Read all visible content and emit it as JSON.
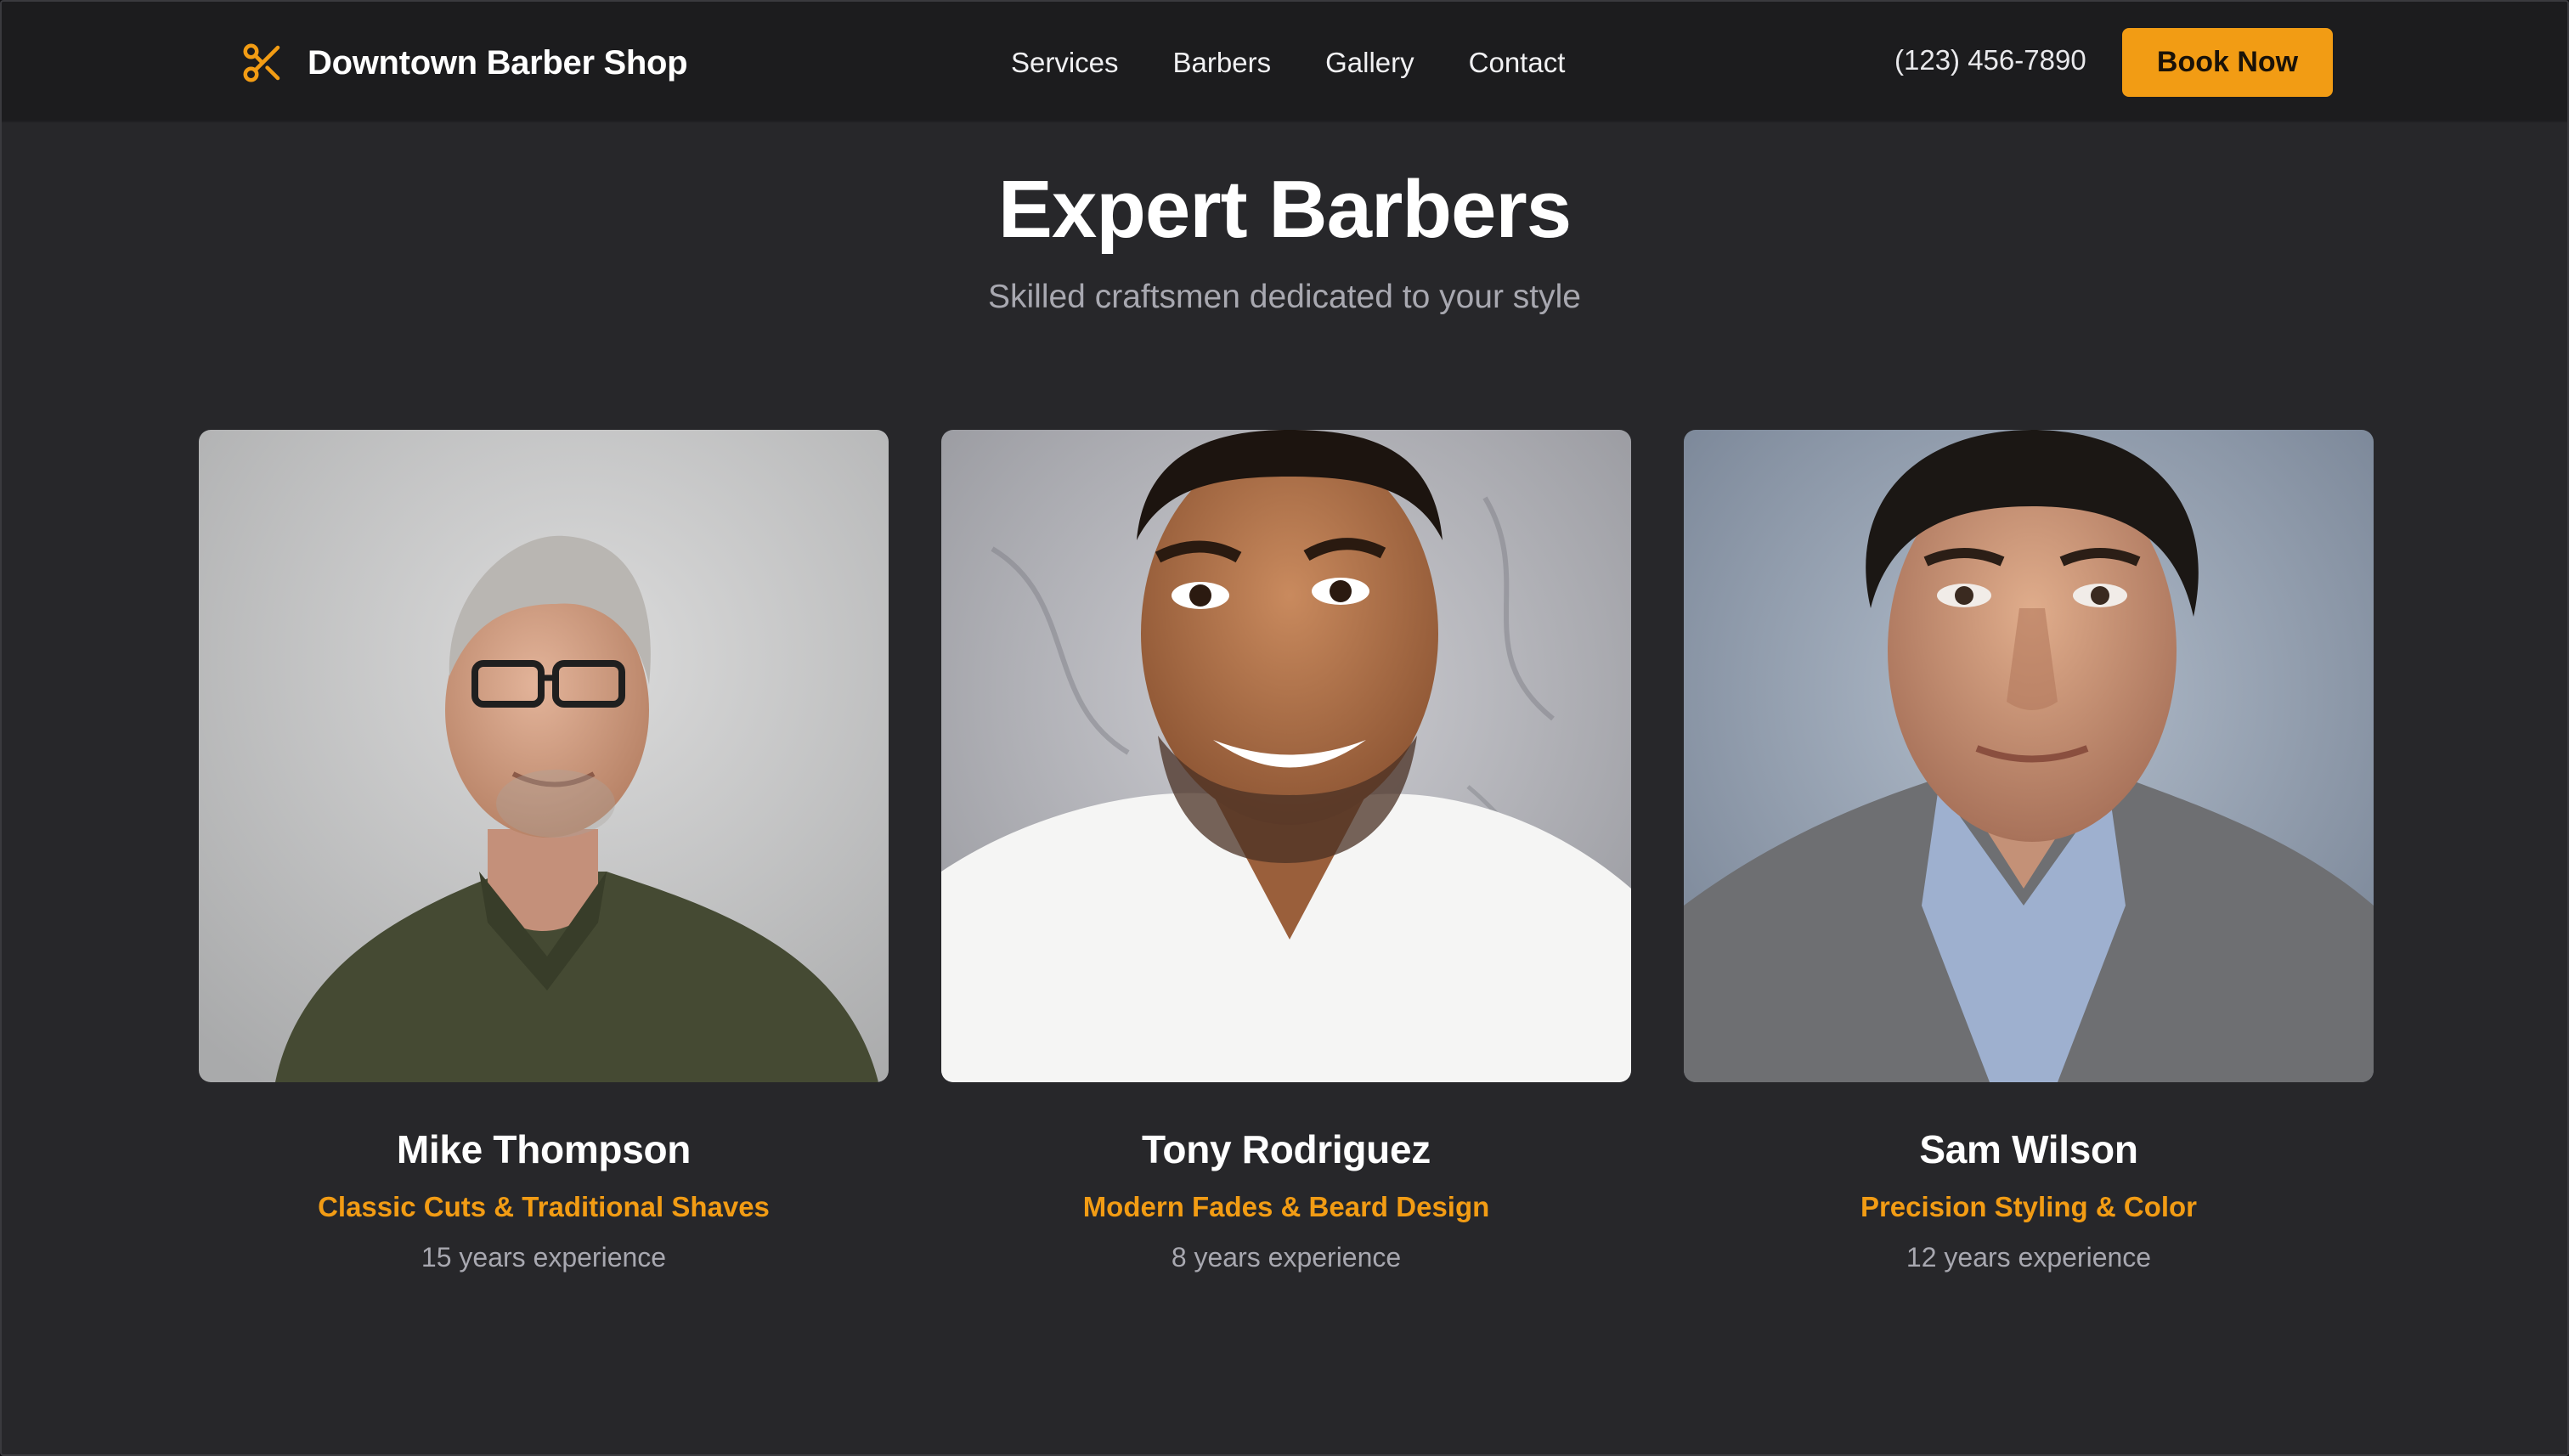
{
  "navbar": {
    "brand_name": "Downtown Barber Shop",
    "brand_icon": "scissors-icon",
    "links": [
      "Services",
      "Barbers",
      "Gallery",
      "Contact"
    ],
    "phone": "(123) 456-7890",
    "cta_label": "Book Now"
  },
  "section": {
    "title": "Expert Barbers",
    "subtitle": "Skilled craftsmen dedicated to your style"
  },
  "barbers": [
    {
      "name": "Mike Thompson",
      "specialty": "Classic Cuts & Traditional Shaves",
      "experience": "15 years experience"
    },
    {
      "name": "Tony Rodriguez",
      "specialty": "Modern Fades & Beard Design",
      "experience": "8 years experience"
    },
    {
      "name": "Sam Wilson",
      "specialty": "Precision Styling & Color",
      "experience": "12 years experience"
    }
  ],
  "colors": {
    "accent": "#f29c14",
    "background": "#27272a",
    "navbar": "#1c1c1e",
    "muted_text": "#a8a8b0"
  }
}
